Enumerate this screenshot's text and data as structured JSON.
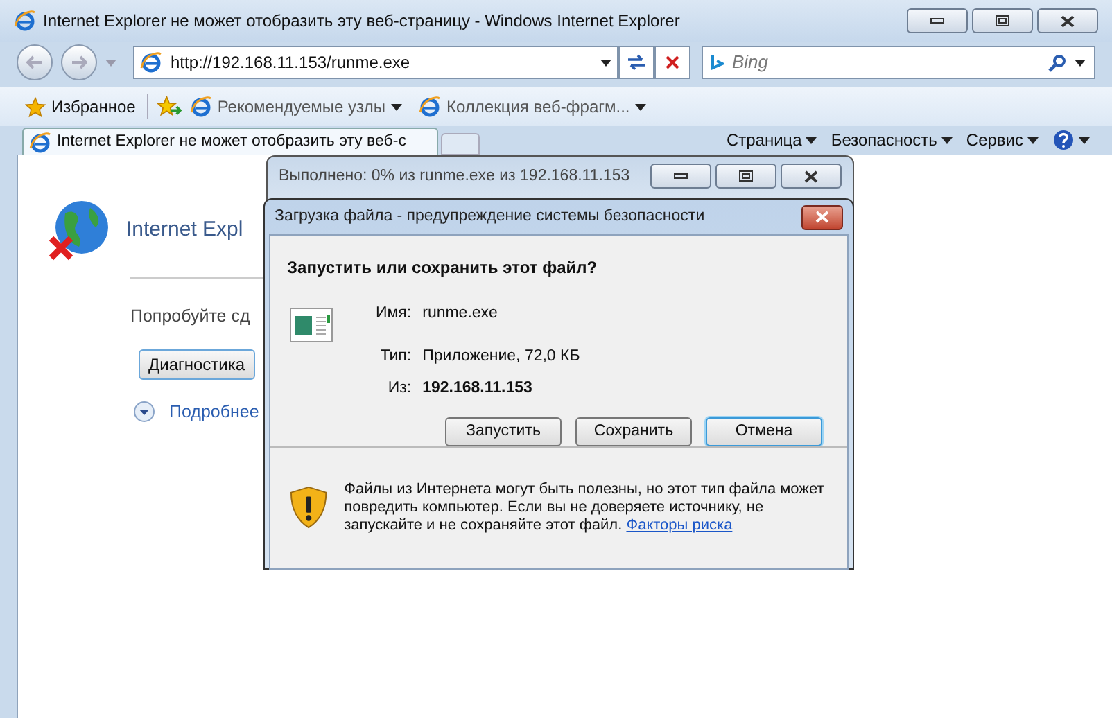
{
  "window": {
    "title": "Internet Explorer не может отобразить эту веб-страницу - Windows Internet Explorer"
  },
  "nav": {
    "address": "http://192.168.11.153/runme.exe",
    "search_placeholder": "Bing"
  },
  "favorites": {
    "label": "Избранное",
    "links": [
      "Рекомендуемые узлы",
      "Коллекция веб-фрагм..."
    ]
  },
  "tab": {
    "title": "Internet Explorer не может отобразить эту веб-с",
    "selected": true
  },
  "command_menus": [
    "Страница",
    "Безопасность",
    "Сервис"
  ],
  "page": {
    "heading": "Internet Expl",
    "hint": "Попробуйте сд",
    "button": "Диагностика",
    "more": "Подробнее"
  },
  "progress_window": {
    "title": "Выполнено: 0% из runme.exe из 192.168.11.153"
  },
  "security_dialog": {
    "title": "Загрузка файла - предупреждение системы безопасности",
    "question": "Запустить или сохранить этот файл?",
    "fields": [
      {
        "label": "Имя:",
        "value": "runme.exe",
        "bold": false
      },
      {
        "label": "Тип:",
        "value": "Приложение, 72,0 КБ",
        "bold": false
      },
      {
        "label": "Из:",
        "value": "192.168.11.153",
        "bold": true
      }
    ],
    "buttons": [
      {
        "label": "Запустить",
        "focused": false
      },
      {
        "label": "Сохранить",
        "focused": false
      },
      {
        "label": "Отмена",
        "focused": true
      }
    ],
    "warning": {
      "text": "Файлы из Интернета могут быть полезны, но этот тип файла может повредить компьютер. Если вы не доверяете источнику, не запускайте и не сохраняйте этот файл.",
      "link": "Факторы риска"
    }
  }
}
